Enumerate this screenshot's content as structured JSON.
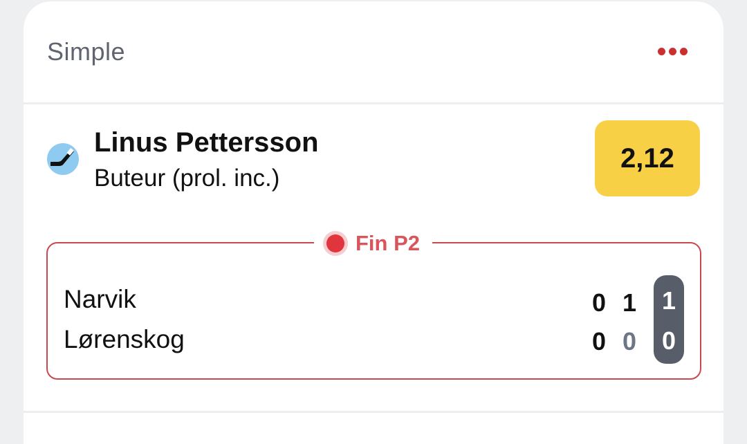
{
  "card": {
    "title": "Simple",
    "menu_icon": "more-dots-icon",
    "accent_color": "#c9302f"
  },
  "selection": {
    "sport_icon": "hockey-stick-icon",
    "player": "Linus Pettersson",
    "market": "Buteur (prol. inc.)",
    "odds": "2,12",
    "odds_color": "#f7d046"
  },
  "match": {
    "status": "Fin P2",
    "status_color": "#d9555c",
    "teams": [
      {
        "name": "Narvik",
        "periods": [
          "0",
          "1"
        ],
        "total": "1"
      },
      {
        "name": "Lørenskog",
        "periods": [
          "0",
          "0"
        ],
        "total": "0"
      }
    ]
  }
}
